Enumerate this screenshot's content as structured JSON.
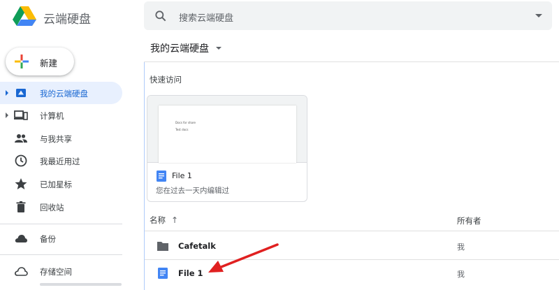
{
  "app": {
    "name": "云端硬盘"
  },
  "search": {
    "placeholder": "搜索云端硬盘"
  },
  "new_button": {
    "label": "新建"
  },
  "sidebar": {
    "items": [
      {
        "label": "我的云端硬盘",
        "icon": "my-drive-icon",
        "active": true
      },
      {
        "label": "计算机",
        "icon": "computers-icon"
      },
      {
        "label": "与我共享",
        "icon": "shared-people-icon"
      },
      {
        "label": "我最近用过",
        "icon": "clock-icon"
      },
      {
        "label": "已加星标",
        "icon": "star-icon"
      },
      {
        "label": "回收站",
        "icon": "trash-icon"
      },
      {
        "label": "备份",
        "icon": "cloud-filled-icon"
      },
      {
        "label": "存储空间",
        "icon": "cloud-outline-icon"
      }
    ]
  },
  "main": {
    "breadcrumb": "我的云端硬盘",
    "quick_access": {
      "title": "快速访问",
      "card": {
        "preview_line1": "Docs for share",
        "preview_line2": "Test docs",
        "name": "File 1",
        "subtitle": "您在过去一天内编辑过"
      }
    },
    "list": {
      "col_name": "名称",
      "col_owner": "所有者",
      "rows": [
        {
          "name": "Cafetalk",
          "type": "folder",
          "owner": "我"
        },
        {
          "name": "File 1",
          "type": "doc",
          "owner": "我"
        }
      ]
    }
  },
  "colors": {
    "accent_blue": "#1a73e8",
    "active_bg": "#e8f0fe",
    "arrow_red": "#e02020"
  }
}
